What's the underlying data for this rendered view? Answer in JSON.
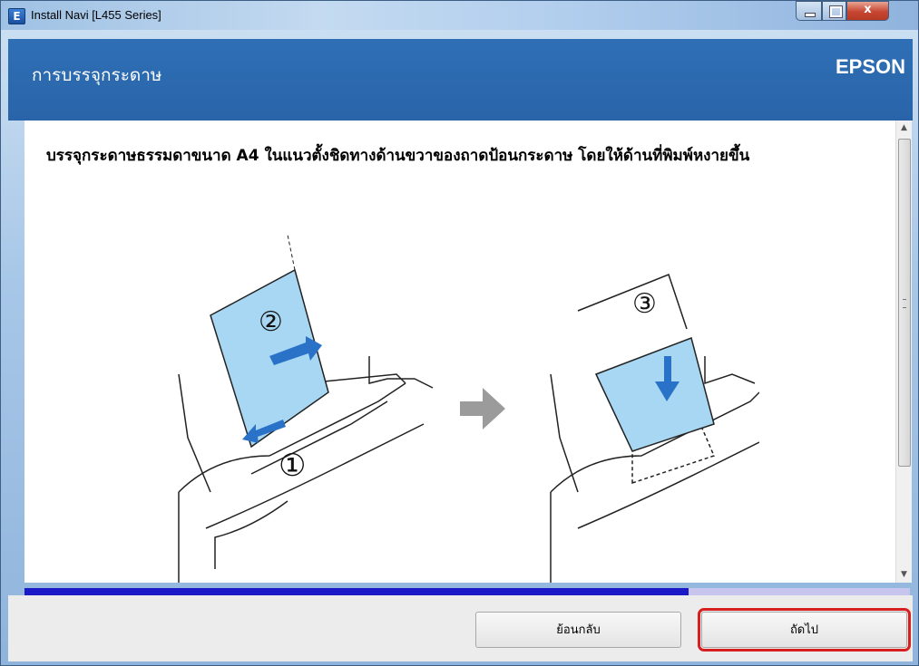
{
  "window": {
    "title": "Install Navi [L455 Series]",
    "app_icon_letter": "E",
    "close_glyph": "x"
  },
  "header": {
    "title": "การบรรจุกระดาษ",
    "brand": "EPSON"
  },
  "content": {
    "instruction": "บรรจุกระดาษธรรมดาขนาด A4 ในแนวตั้งชิดทางด้านขวาของถาดป้อนกระดาษ โดยให้ด้านที่พิมพ์หงายขึ้น",
    "step_labels": [
      "②",
      "①",
      "③"
    ],
    "colors": {
      "paper": "#a7d7f3",
      "arrow": "#2a71c8",
      "transition_arrow": "#9b9b9b"
    }
  },
  "progress": {
    "fraction": 0.75,
    "fill_color": "#1c1ac7",
    "track_color": "#c7c4ee"
  },
  "footer": {
    "back_label": "ย้อนกลับ",
    "next_label": "ถัดไป",
    "highlight_color": "#d71f1f"
  },
  "icons": {
    "scroll_up": "▲",
    "scroll_down": "▼"
  }
}
